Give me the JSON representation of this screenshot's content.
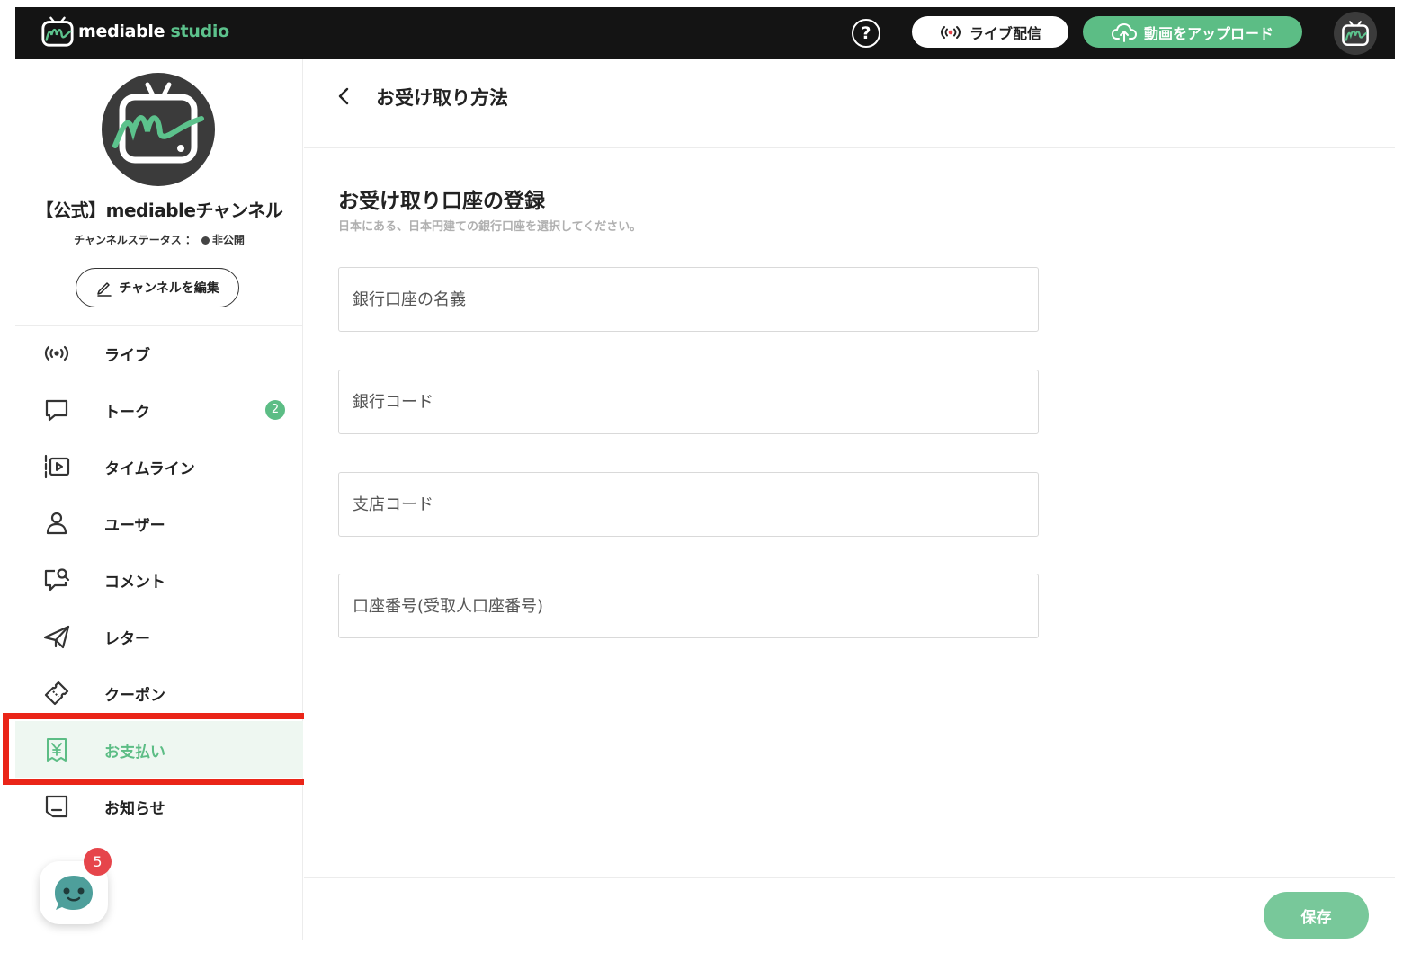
{
  "header": {
    "brand_main": "mediable",
    "brand_sub": "studio",
    "help_glyph": "?",
    "live_label": "ライブ配信",
    "upload_label": "動画をアップロード"
  },
  "sidebar": {
    "channel_name": "【公式】mediableチャンネル",
    "status_label": "チャンネルステータス ：",
    "status_value": "非公開",
    "edit_label": "チャンネルを編集",
    "items": [
      {
        "id": "live",
        "label": "ライブ",
        "icon": "live-broadcast-icon"
      },
      {
        "id": "talk",
        "label": "トーク",
        "icon": "chat-bubble-icon",
        "badge": "2"
      },
      {
        "id": "timeline",
        "label": "タイムライン",
        "icon": "timeline-icon"
      },
      {
        "id": "users",
        "label": "ユーザー",
        "icon": "user-icon"
      },
      {
        "id": "comments",
        "label": "コメント",
        "icon": "comment-search-icon"
      },
      {
        "id": "letter",
        "label": "レター",
        "icon": "paper-plane-icon"
      },
      {
        "id": "coupon",
        "label": "クーポン",
        "icon": "ticket-icon"
      },
      {
        "id": "payment",
        "label": "お支払い",
        "icon": "yen-receipt-icon",
        "active": true
      },
      {
        "id": "news",
        "label": "お知らせ",
        "icon": "notice-icon"
      }
    ],
    "chat_badge": "5"
  },
  "main": {
    "title": "お受け取り方法",
    "section_title": "お受け取り口座の登録",
    "section_subtitle": "日本にある、日本円建ての銀行口座を選択してください。",
    "fields": {
      "account_name": {
        "placeholder": "銀行口座の名義"
      },
      "bank_code": {
        "placeholder": "銀行コード"
      },
      "branch_code": {
        "placeholder": "支店コード"
      },
      "account_number": {
        "placeholder": "口座番号(受取人口座番号)"
      }
    },
    "save_label": "保存"
  },
  "colors": {
    "accent": "#5cbd85",
    "header_bg": "#141414",
    "highlight": "#ea2518",
    "badge_red": "#e6454b"
  }
}
